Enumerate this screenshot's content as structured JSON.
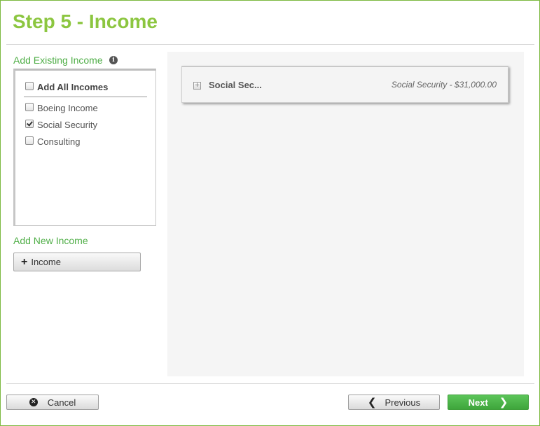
{
  "page": {
    "title": "Step 5 - Income"
  },
  "existing": {
    "label": "Add Existing Income",
    "info_icon": "info-icon",
    "add_all_label": "Add All Incomes",
    "add_all_checked": false,
    "items": [
      {
        "label": "Boeing Income",
        "checked": false
      },
      {
        "label": "Social Security",
        "checked": true
      },
      {
        "label": "Consulting",
        "checked": false
      }
    ]
  },
  "new_income": {
    "label": "Add New Income",
    "button_icon": "plus-icon",
    "button_label": "Income"
  },
  "main": {
    "cards": [
      {
        "name": "Social Sec...",
        "summary": "Social Security - $31,000.00",
        "expand_icon": "expand-icon"
      }
    ]
  },
  "footer": {
    "cancel_label": "Cancel",
    "previous_label": "Previous",
    "next_label": "Next"
  },
  "colors": {
    "title": "#8cc640",
    "section_label": "#4fae47",
    "next_button": "#4cb648",
    "panel_bg": "#f5f5f5",
    "frame_border": "#7cb940"
  }
}
